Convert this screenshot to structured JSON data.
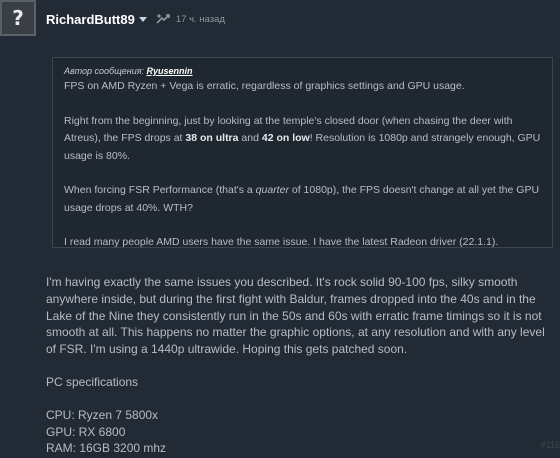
{
  "avatar": {
    "glyph": "?"
  },
  "author": {
    "name": "RichardButt89",
    "time": "17 ч. назад"
  },
  "quote": {
    "header_prefix": "Автор сообщения:",
    "header_name": "Ryusennin",
    "line1": "FPS on AMD Ryzen + Vega is erratic, regardless of graphics settings and GPU usage.",
    "p2_a": "Right from the beginning, just by looking at the temple's closed door (when chasing the deer with Atreus), the FPS drops at ",
    "p2_b": "38 on ultra",
    "p2_c": " and ",
    "p2_d": "42 on low",
    "p2_e": "! Resolution is 1080p and strangely enough, GPU usage is 80%.",
    "p3_a": "When forcing FSR Performance (that's a ",
    "p3_b": "quarter",
    "p3_c": " of 1080p), the FPS doesn't change at all yet the GPU usage drops at 40%. WTH?",
    "p4": "I read many people AMD users have the same issue. I have the latest Radeon driver (22.1.1)."
  },
  "body": {
    "p1": "I'm having exactly the same issues you described. It's rock solid 90-100 fps, silky smooth anywhere inside, but during the first fight with Baldur, frames dropped into the 40s and in the Lake of the Nine they consistently run in the 50s and 60s with erratic frame timings so it is not smooth at all. This happens no matter the graphic options, at any resolution and with any level of FSR. I'm using a 1440p ultrawide. Hoping this gets patched soon.",
    "p2": "PC specifications",
    "cpu": "CPU: Ryzen 7 5800x",
    "gpu": "GPU: RX 6800",
    "ram": "RAM: 16GB 3200 mhz"
  },
  "post_number": "#116",
  "icons": {
    "award": "award-icon",
    "dropdown": "chevron-down-icon"
  },
  "colors": {
    "background": "#222b35",
    "author": "#ffffff",
    "text": "#b6bcc2",
    "quote_border": "#3d4650"
  }
}
